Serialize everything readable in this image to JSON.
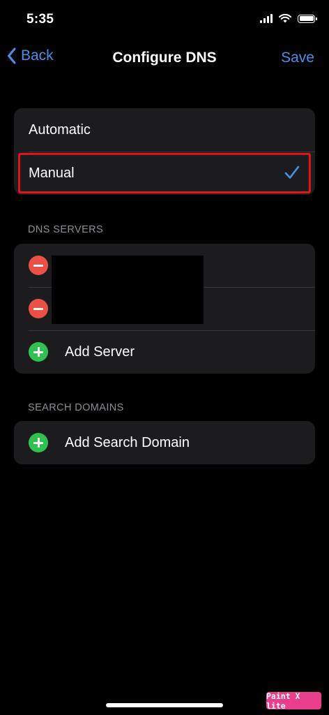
{
  "status_bar": {
    "time": "5:35"
  },
  "nav": {
    "back_label": "Back",
    "title": "Configure DNS",
    "save_label": "Save"
  },
  "mode_options": [
    {
      "label": "Automatic",
      "selected": false
    },
    {
      "label": "Manual",
      "selected": true
    }
  ],
  "dns_servers": {
    "header": "DNS SERVERS",
    "servers_redacted": 2,
    "add_label": "Add Server"
  },
  "search_domains": {
    "header": "SEARCH DOMAINS",
    "add_label": "Add Search Domain"
  },
  "watermark": "Paint X lite",
  "colors": {
    "accent": "#4a8fe8",
    "highlight": "#e0151b",
    "remove": "#eb5047",
    "add": "#30c151"
  }
}
